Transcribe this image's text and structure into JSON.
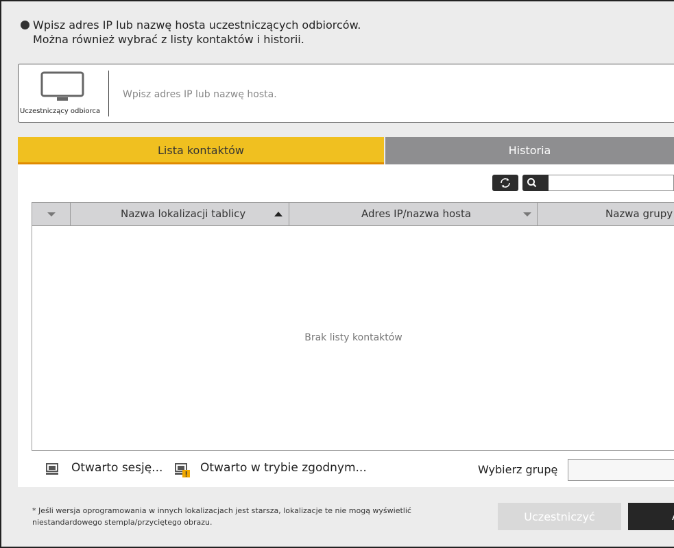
{
  "instructions": {
    "line1": "Wpisz adres IP lub nazwę hosta uczestniczących odbiorców.",
    "line2": "Można również wybrać z listy kontaktów i historii."
  },
  "recipient": {
    "label": "Uczestniczący odbiorca",
    "icon": "monitor-icon",
    "input_placeholder": "Wpisz adres IP lub nazwę hosta.",
    "input_value": ""
  },
  "tabs": [
    {
      "label": "Lista kontaktów",
      "active": true
    },
    {
      "label": "Historia",
      "active": false
    }
  ],
  "toolbar": {
    "refresh_icon": "refresh-icon",
    "search_icon": "search-icon",
    "search_value": ""
  },
  "table": {
    "columns": [
      {
        "label": ""
      },
      {
        "label": "Nazwa lokalizacji tablicy"
      },
      {
        "label": "Adres IP/nazwa hosta"
      },
      {
        "label": "Nazwa grupy"
      }
    ],
    "rows": [],
    "empty_message": "Brak listy kontaktów"
  },
  "legend": {
    "session_open": "Otwarto sesję...",
    "compat_open": "Otwarto w trybie zgodnym..."
  },
  "group": {
    "label": "Wybierz grupę",
    "selected": ""
  },
  "footnote": {
    "line1": "* Jeśli wersja oprogramowania w innych lokalizacjach jest starsza, lokalizacje te nie mogą wyświetlić",
    "line2": "niestandardowego stempla/przyciętego obrazu."
  },
  "buttons": {
    "join": "Uczestniczyć",
    "next": "A"
  },
  "colors": {
    "tab_active": "#f0c020",
    "tab_active_underline": "#e08a00",
    "tab_inactive": "#8e8e90",
    "warning": "#f0a800"
  }
}
